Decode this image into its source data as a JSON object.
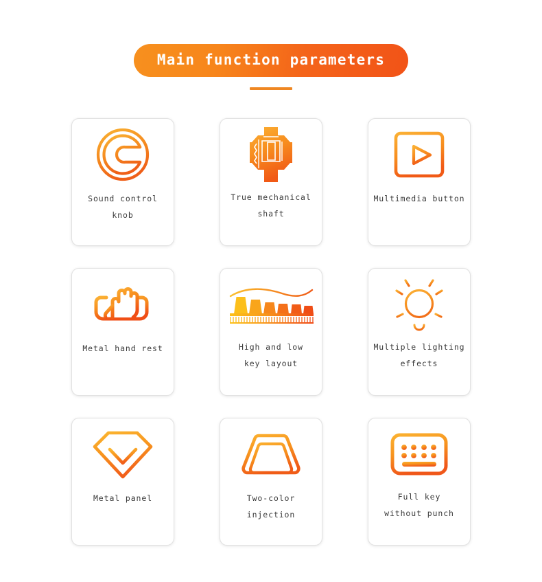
{
  "header": {
    "title": "Main function parameters",
    "underline_color": "#ef8722",
    "pill_gradient_from": "#f7901e",
    "pill_gradient_to": "#f25317",
    "title_color": "#ffffff"
  },
  "theme": {
    "background": "#ffffff",
    "card_background": "#ffffff",
    "card_border": "#e2e2e2",
    "label_color": "#3a3a3a",
    "accent_light": "#f9b233",
    "accent_mid": "#f7901e",
    "accent_deep": "#f25317"
  },
  "features": [
    {
      "icon": "volume-knob-icon",
      "label": "Sound control knob"
    },
    {
      "icon": "mechanical-switch-icon",
      "label": "True mechanical\nshaft"
    },
    {
      "icon": "media-player-icon",
      "label": "Multimedia button"
    },
    {
      "icon": "hand-rest-icon",
      "label": "Metal hand rest"
    },
    {
      "icon": "stepped-keycaps-icon",
      "label": "High and low\nkey layout"
    },
    {
      "icon": "light-bulb-icon",
      "label": "Multiple lighting\neffects"
    },
    {
      "icon": "diamond-panel-icon",
      "label": "Metal panel"
    },
    {
      "icon": "keycap-outline-icon",
      "label": "Two-color injection"
    },
    {
      "icon": "keyboard-icon",
      "label": "Full key\nwithout punch"
    }
  ]
}
